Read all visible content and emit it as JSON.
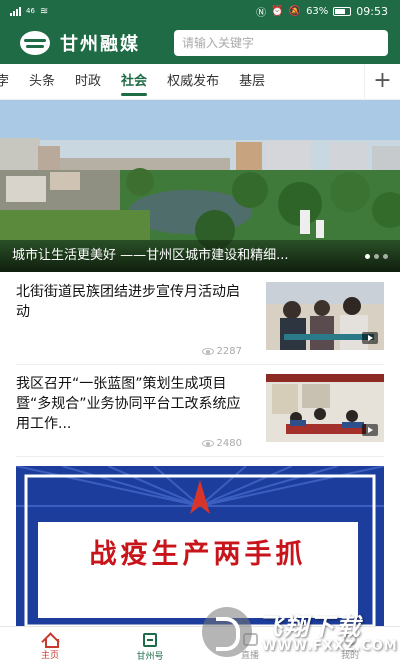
{
  "status_bar": {
    "signal_label": "46",
    "battery_percent": "63%",
    "time": "09:53"
  },
  "header": {
    "app_title": "甘州融媒",
    "search_placeholder": "请输入关键字",
    "accent_color": "#1e6b46"
  },
  "tabs": [
    {
      "label": "孛"
    },
    {
      "label": "头条"
    },
    {
      "label": "时政"
    },
    {
      "label": "社会"
    },
    {
      "label": "权威发布"
    },
    {
      "label": "基层"
    }
  ],
  "active_tab": "社会",
  "banner": {
    "caption": "城市让生活更美好 ——甘州区城市建设和精细..."
  },
  "news": [
    {
      "title": "北街街道民族团结进步宣传月活动启动",
      "views": "2287"
    },
    {
      "title": "我区召开“一张蓝图”策划生成项目暨“多规合”业务协同平台工改系统应用工作...",
      "views": "2480"
    }
  ],
  "poster": {
    "text": "战疫生产两手抓",
    "text_color": "#c8141b",
    "bg_color": "#1c3d9c"
  },
  "bottom_nav": [
    {
      "label": "主页",
      "icon": "home-icon"
    },
    {
      "label": "甘州号",
      "icon": "book-icon"
    },
    {
      "label": "直播",
      "icon": "radio-icon"
    },
    {
      "label": "我的",
      "icon": "user-icon"
    }
  ],
  "watermark": {
    "title": "飞翔下载",
    "sub": "WWW.FXXZ.COM"
  }
}
